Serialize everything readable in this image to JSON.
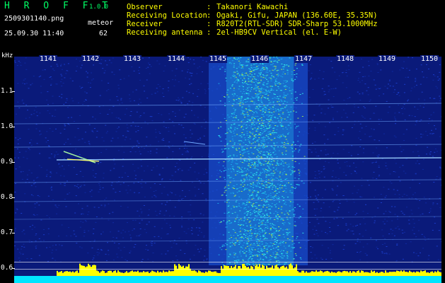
{
  "header": {
    "app_name": "H R O F F T",
    "version": "1.0.0",
    "filename": "2509301140.png",
    "detection_type": "meteor",
    "datetime": "25.09.30 11:40",
    "count": "62",
    "info": [
      {
        "label": "Observer",
        "value": "Takanori Kawachi"
      },
      {
        "label": "Receiving Location",
        "value": "Ogaki, Gifu, JAPAN (136.60E, 35.35N)"
      },
      {
        "label": "Receiver",
        "value": "R820T2(RTL-SDR) SDR-Sharp 53.1000MHz"
      },
      {
        "label": "Receiving antenna",
        "value": "2el-HB9CV Vertical (el. E-W)"
      }
    ]
  },
  "spectrogram": {
    "y_unit": "kHz",
    "x_ticks": [
      "1141",
      "1142",
      "1143",
      "1144",
      "1145",
      "1146",
      "1147",
      "1148",
      "1149",
      "1150"
    ],
    "y_ticks": [
      "1.1",
      "1.0",
      "0.9",
      "0.8",
      "0.7",
      "0.6"
    ],
    "colors": {
      "background": "#0a1a7a",
      "noise_band": "#1ec8e6",
      "signal_yellow": "#ffff00",
      "baseline": "#00e5ff"
    }
  }
}
